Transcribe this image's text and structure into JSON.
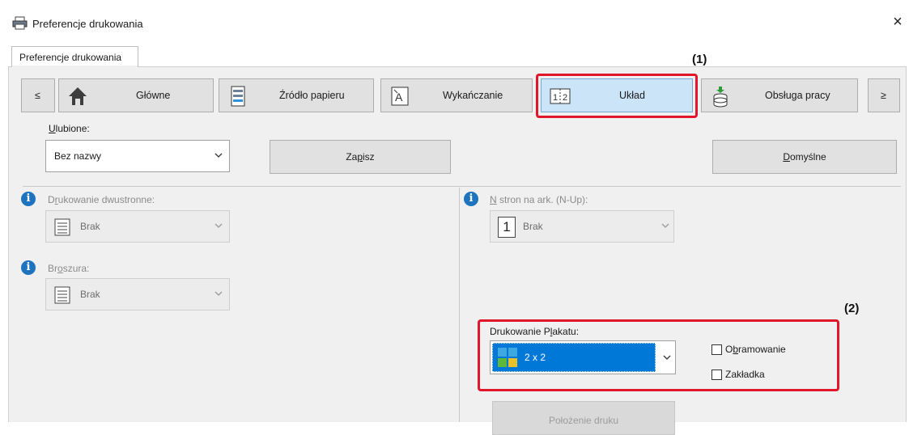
{
  "window": {
    "title": "Preferencje drukowania",
    "close_glyph": "×",
    "icon": "printer-icon"
  },
  "tab": {
    "label": "Preferencje drukowania"
  },
  "nav": {
    "prev_glyph": "≤",
    "next_glyph": "≥",
    "items": [
      {
        "label": "Główne",
        "icon": "home-icon"
      },
      {
        "label": "Źródło papieru",
        "icon": "paper-tray-icon"
      },
      {
        "label": "Wykańczanie",
        "icon": "finishing-icon"
      },
      {
        "label": "Układ",
        "icon": "layout-icon",
        "active": true
      },
      {
        "label": "Obsługa pracy",
        "icon": "job-handling-icon"
      }
    ]
  },
  "favorites": {
    "label_first": "U",
    "label_rest": "lubione:",
    "value": "Bez nazwy",
    "save_first": "Za",
    "save_u": "p",
    "save_rest": "isz",
    "defaults_first": "D",
    "defaults_rest": "omyślne"
  },
  "left": {
    "duplex": {
      "label_first": "D",
      "label_u": "r",
      "label_rest": "ukowanie dwustronne:",
      "value": "Brak"
    },
    "booklet": {
      "label_first": "Br",
      "label_u": "o",
      "label_rest": "szura:",
      "value": "Brak"
    }
  },
  "right": {
    "nup": {
      "label_u": "N",
      "label_rest": " stron na ark. (N-Up):",
      "value": "Brak",
      "icon_text": "1"
    },
    "poster": {
      "label_first": "Drukowanie P",
      "label_u": "l",
      "label_rest": "akatu:",
      "value": "2 x 2",
      "border_first": "O",
      "border_u": "b",
      "border_rest": "ramowanie",
      "tab_label": "Zakładka"
    },
    "print_position": "Położenie druku"
  },
  "callouts": {
    "one": "(1)",
    "two": "(2)"
  },
  "colors": {
    "highlight": "#e0162b",
    "accent": "#0078d7",
    "active_tab": "#cce4f7"
  }
}
